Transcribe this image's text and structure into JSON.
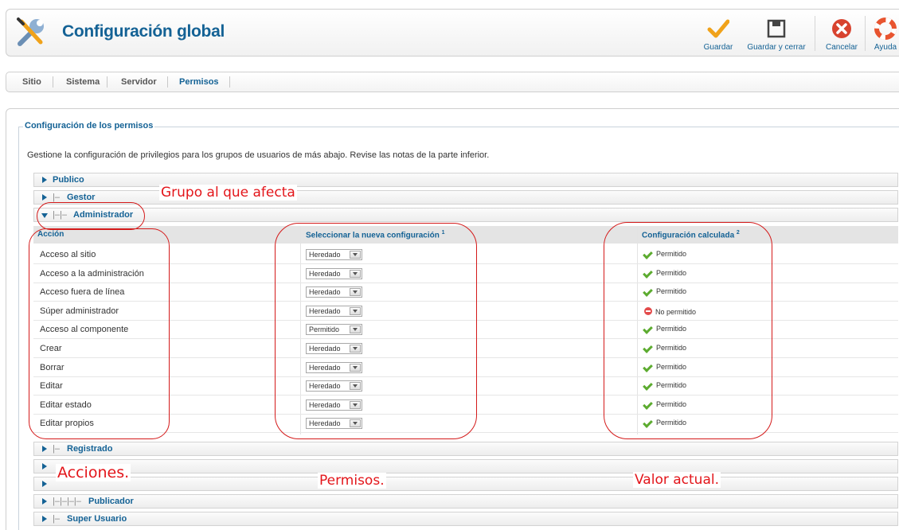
{
  "header": {
    "title": "Configuración global",
    "buttons": {
      "save": "Guardar",
      "save_close": "Guardar y cerrar",
      "cancel": "Cancelar",
      "help": "Ayuda"
    }
  },
  "tabs": [
    "Sitio",
    "Sistema",
    "Servidor",
    "Permisos"
  ],
  "permissions": {
    "legend": "Configuración de los permisos",
    "description": "Gestione la configuración de privilegios para los grupos de usuarios de más abajo. Revise las notas de la parte inferior.",
    "groups_top": [
      {
        "tree": "",
        "name": "Publico"
      },
      {
        "tree": "|–",
        "name": "Gestor"
      },
      {
        "tree": "|–|–",
        "name": "Administrador"
      }
    ],
    "columns": {
      "action": "Acción",
      "new_setting": "Seleccionar la nueva configuración",
      "new_setting_note": "1",
      "calculated": "Configuración calculada",
      "calculated_note": "2"
    },
    "rows": [
      {
        "action": "Acceso al sitio",
        "select": "Heredado",
        "calc": "Permitido",
        "allowed": true
      },
      {
        "action": "Acceso a la administración",
        "select": "Heredado",
        "calc": "Permitido",
        "allowed": true
      },
      {
        "action": "Acceso fuera de línea",
        "select": "Heredado",
        "calc": "Permitido",
        "allowed": true
      },
      {
        "action": "Súper administrador",
        "select": "Heredado",
        "calc": "No permitido",
        "allowed": false
      },
      {
        "action": "Acceso al componente",
        "select": "Permitido",
        "calc": "Permitido",
        "allowed": true
      },
      {
        "action": "Crear",
        "select": "Heredado",
        "calc": "Permitido",
        "allowed": true
      },
      {
        "action": "Borrar",
        "select": "Heredado",
        "calc": "Permitido",
        "allowed": true
      },
      {
        "action": "Editar",
        "select": "Heredado",
        "calc": "Permitido",
        "allowed": true
      },
      {
        "action": "Editar estado",
        "select": "Heredado",
        "calc": "Permitido",
        "allowed": true
      },
      {
        "action": "Editar propios",
        "select": "Heredado",
        "calc": "Permitido",
        "allowed": true
      }
    ],
    "groups_bottom": [
      {
        "tree": "|–",
        "name": "Registrado"
      },
      {
        "tree": "",
        "name": ""
      },
      {
        "tree": "",
        "name": ""
      },
      {
        "tree": "|–|–|–|–",
        "name": "Publicador"
      },
      {
        "tree": "|–",
        "name": "Super Usuario"
      }
    ]
  },
  "annotations": {
    "group": "Grupo al que afecta",
    "actions": "Acciones.",
    "permissions": "Permisos.",
    "current": "Valor actual."
  },
  "colors": {
    "link": "#146295",
    "annotation": "#e3151a",
    "allowed": "#5cab2f",
    "denied": "#e34b4b"
  }
}
